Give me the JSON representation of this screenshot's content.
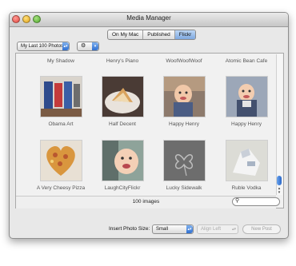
{
  "window": {
    "title": "Media Manager"
  },
  "tabs": [
    {
      "label": "On My Mac",
      "active": false
    },
    {
      "label": "Published",
      "active": false
    },
    {
      "label": "Flickr",
      "active": true
    }
  ],
  "toolbar": {
    "source_popup": "My Last 100 Photos",
    "action_icon": "gear-icon"
  },
  "photos": [
    {
      "title": "My Shadow"
    },
    {
      "title": "Henry's Piano"
    },
    {
      "title": "WoofWoofWoof"
    },
    {
      "title": "Atomic Bean Cafe"
    },
    {
      "title": "Obama Art"
    },
    {
      "title": "Half Decent"
    },
    {
      "title": "Happy Henry"
    },
    {
      "title": "Happy Henry"
    },
    {
      "title": "A Very Cheesy Pizza"
    },
    {
      "title": "LaughCityFlickr"
    },
    {
      "title": "Lucky Sidewalk"
    },
    {
      "title": "Ruble Vodka"
    }
  ],
  "status": {
    "count": "100 images",
    "search_placeholder": ""
  },
  "bottom": {
    "insert_label": "Insert Photo Size:",
    "size_popup": "Small",
    "align_popup": "Align Left",
    "new_post_button": "New Post"
  },
  "colors": {
    "accent": "#3b7ad9"
  }
}
